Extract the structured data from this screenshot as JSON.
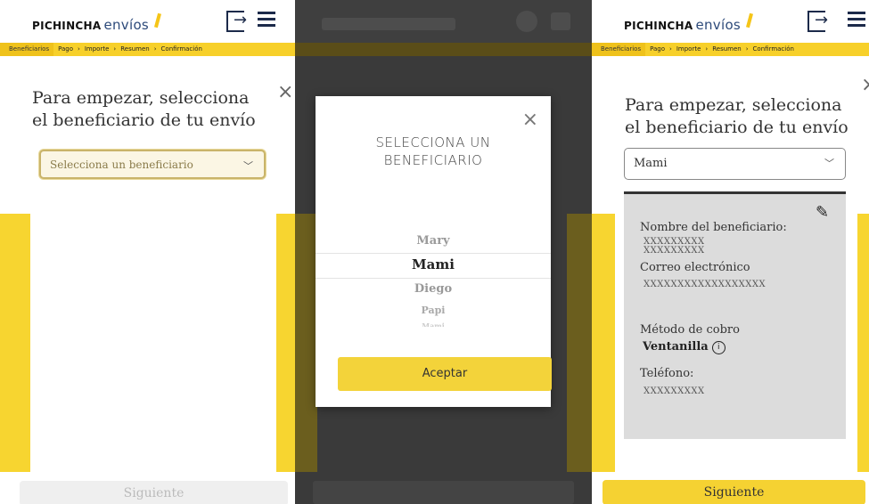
{
  "header": {
    "brand": "PICHINCHA",
    "brand_sub": "envíos",
    "breadcrumbs": [
      "Beneficiarios",
      "Pago",
      "Importe",
      "Resumen",
      "Confirmación"
    ]
  },
  "screen1": {
    "heading": "Para empezar, selecciona el beneficiario de tu envío",
    "select_placeholder": "Selecciona un beneficiario",
    "next_label": "Siguiente"
  },
  "screen2": {
    "modal_title": "SELECCIONA UN BENEFICIARIO",
    "options": [
      "Mary",
      "Mami",
      "Diego",
      "Papi",
      "Mami"
    ],
    "selected": "Mami",
    "accept_label": "Aceptar"
  },
  "screen3": {
    "heading": "Para empezar, selecciona el beneficiario de tu envío",
    "select_value": "Mami",
    "name_label": "Nombre del beneficiario:",
    "name_value_1": "XXXXXXXXX",
    "name_value_2": "XXXXXXXXX",
    "email_label": "Correo electrónico",
    "email_value": "XXXXXXXXXXXXXXXXXX",
    "method_label": "Método de cobro",
    "method_value": "Ventanilla",
    "info_glyph": "i",
    "phone_label": "Teléfono:",
    "phone_value": "XXXXXXXXX",
    "next_label": "Siguiente"
  },
  "icons": {
    "close": "×",
    "chevron": "﹀",
    "logout_arrow": "→",
    "edit": "✎"
  },
  "colors": {
    "accent": "#f7d530",
    "navy": "#1c2a4a",
    "card_bg": "#dcdcdc"
  }
}
